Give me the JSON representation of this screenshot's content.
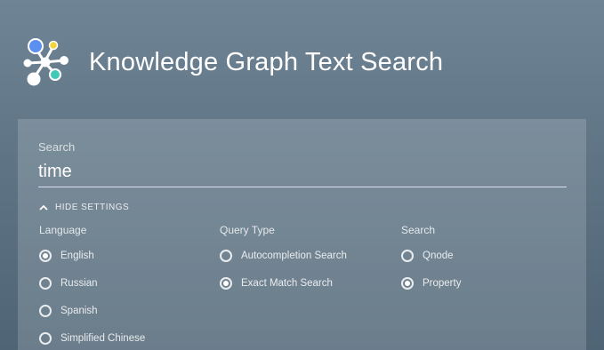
{
  "app": {
    "title": "Knowledge Graph Text Search"
  },
  "search": {
    "label": "Search",
    "value": "time"
  },
  "settings_toggle": {
    "label": "HIDE SETTINGS"
  },
  "language": {
    "label": "Language",
    "options": [
      {
        "label": "English",
        "checked": true
      },
      {
        "label": "Russian",
        "checked": false
      },
      {
        "label": "Spanish",
        "checked": false
      },
      {
        "label": "Simplified Chinese",
        "checked": false
      }
    ]
  },
  "query_type": {
    "label": "Query Type",
    "options": [
      {
        "label": "Autocompletion Search",
        "checked": false
      },
      {
        "label": "Exact Match Search",
        "checked": true
      }
    ]
  },
  "search_target": {
    "label": "Search",
    "options": [
      {
        "label": "Qnode",
        "checked": false
      },
      {
        "label": "Property",
        "checked": true
      }
    ]
  },
  "colors": {
    "logo_blue": "#5b8ff0",
    "logo_yellow": "#f5d33a",
    "logo_teal": "#3fc9b8",
    "text": "#ffffff"
  }
}
